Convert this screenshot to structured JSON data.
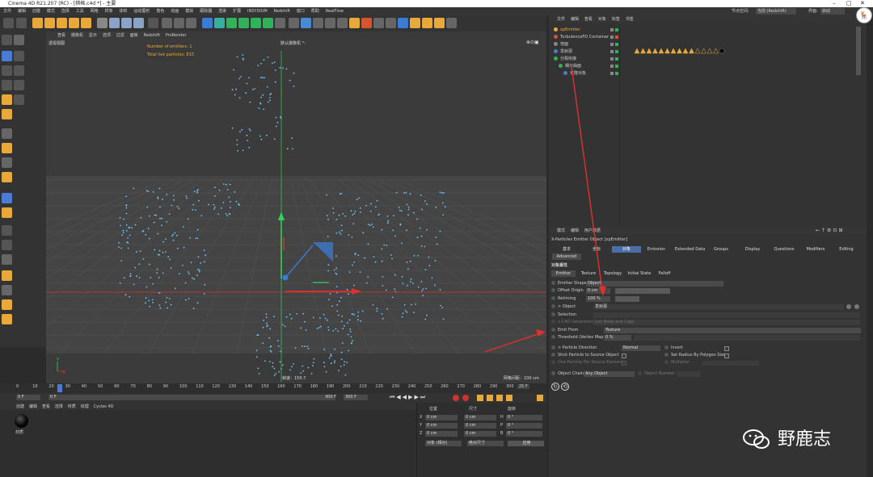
{
  "window": {
    "title": "Cinema 4D R21.207 (RC) - [棋格.c4d *] - 主要"
  },
  "menu": [
    "文件",
    "编辑",
    "创建",
    "模式",
    "选择",
    "工具",
    "网格",
    "样条",
    "体积",
    "运动图形",
    "角色",
    "动画",
    "模拟",
    "跟踪器",
    "渲染",
    "扩展",
    "INSYDIUM",
    "Redshift",
    "窗口",
    "帮助",
    "RealFlow"
  ],
  "layout": {
    "label": "界面:",
    "value": "启动",
    "node_label": "节点空间:",
    "node_value": "当前 (Redshift)"
  },
  "viewport": {
    "menu": [
      "查看",
      "摄像机",
      "显示",
      "选项",
      "过滤",
      "面板",
      "Redshift",
      "ProRender"
    ],
    "view_label": "透视视图",
    "camera_label": "默认摄像机 °:",
    "hud_line1": "Number of emitters: 1",
    "hud_line2": "Total live particles: 833",
    "speed": "帧速：150.7",
    "grid": "网格间距：100 cm"
  },
  "timeline": {
    "ticks": [
      "0",
      "10",
      "20",
      "30",
      "40",
      "50",
      "60",
      "70",
      "80",
      "90",
      "100",
      "110",
      "120",
      "130",
      "140",
      "150",
      "160",
      "170",
      "180",
      "190",
      "200",
      "210",
      "220",
      "230",
      "240",
      "250",
      "260",
      "270",
      "280",
      "290",
      "300"
    ],
    "end_frame": "25 F"
  },
  "transport": {
    "current": "0 F",
    "start": "0 F",
    "end": "300 F",
    "end2": "300 F"
  },
  "materials": {
    "menu": [
      "创建",
      "编辑",
      "查看",
      "选择",
      "材质",
      "纹理",
      "Cycles 4D"
    ],
    "item": "材质"
  },
  "coords": {
    "headers": [
      "位置",
      "尺寸",
      "旋转"
    ],
    "rows": [
      {
        "axis": "X",
        "pos": "0 cm",
        "size": "0 cm",
        "rlabel": "H",
        "rot": "0 °"
      },
      {
        "axis": "Y",
        "pos": "0 cm",
        "size": "0 cm",
        "rlabel": "P",
        "rot": "0 °"
      },
      {
        "axis": "Z",
        "pos": "0 cm",
        "size": "0 cm",
        "rlabel": "B",
        "rot": "0 °"
      }
    ],
    "mode1": "对象 (相对)",
    "mode2": "绝对尺寸",
    "apply": "应用"
  },
  "objects": {
    "menu": [
      "文件",
      "编辑",
      "查看",
      "对象",
      "标签",
      "书签"
    ],
    "items": [
      {
        "name": "xpEmitter",
        "color": "#e8a93a",
        "indent": 0
      },
      {
        "name": "TurbulenceFD Container",
        "color": "#cfcfcf",
        "indent": 0
      },
      {
        "name": "地面",
        "color": "#cfcfcf",
        "indent": 0
      },
      {
        "name": "发射源",
        "color": "#cfcfcf",
        "indent": 0
      },
      {
        "name": "分裂衔接",
        "color": "#cfcfcf",
        "indent": 0
      },
      {
        "name": "细分曲面",
        "color": "#cfcfcf",
        "indent": 1
      },
      {
        "name": "克隆对象",
        "color": "#cfcfcf",
        "indent": 2
      }
    ]
  },
  "attributes": {
    "menu": [
      "模式",
      "编辑",
      "用户数据"
    ],
    "title": "X-Particles Emitter Object [xpEmitter]",
    "tabs": [
      "基本",
      "坐标",
      "对象",
      "Emission",
      "Extended Data",
      "Groups",
      "Display",
      "Questions",
      "Modifiers",
      "Editing"
    ],
    "tab2": "Advanced",
    "section": "对象属性",
    "subtabs": [
      "Emitter",
      "Texture",
      "Topology",
      "Initial State",
      "Falloff"
    ],
    "rows": {
      "shape_label": "Emitter Shape",
      "shape_value": "Object",
      "offset_label": "Offset Origin",
      "offset_value": "0 cm",
      "retiming_label": "Retiming",
      "retiming_value": "100 %",
      "object_label": "> Object",
      "object_value": "发射源",
      "selection_label": "Selection",
      "generators_label": "x-CAD Generators",
      "generators_value": "Use Body and Caps",
      "emit_from_label": "Emit From",
      "emit_from_value": "Texture",
      "threshold_label": "Threshold (Vertex Map)",
      "threshold_value": "0 %",
      "direction_label": "> Particle Direction",
      "direction_value": "Normal",
      "invert_label": "Invert",
      "stick_label": "Stick Particle to Source Object",
      "radius_label": "Set Radius By Polygon Size",
      "one_label": "One Particle Per Source Element",
      "multiplier_label": "Multiplier",
      "chain_label": "Object Chain",
      "chain_value": "Any Object",
      "number_label": "Object Number"
    }
  },
  "watermark": {
    "text": "野鹿志"
  },
  "colors": {
    "accent": "#e8a93a",
    "particle": "#6ec6ff",
    "arrow": "#e03030",
    "axis_y": "#33d05a",
    "axis_x": "#e03030",
    "axis_z": "#3a7bd5"
  }
}
